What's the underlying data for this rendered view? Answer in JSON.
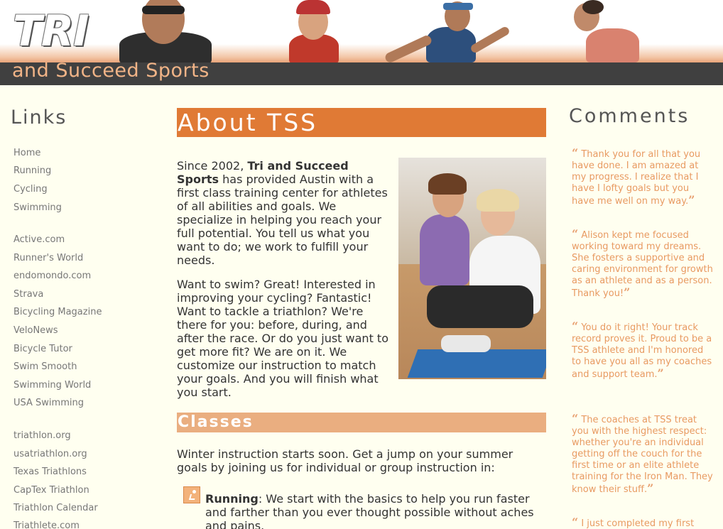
{
  "header": {
    "logo_main": "TRI",
    "logo_sub": "and Succeed Sports"
  },
  "sidebar": {
    "title": "Links",
    "groups": [
      [
        "Home",
        "Running",
        "Cycling",
        "Swimming"
      ],
      [
        "Active.com",
        "Runner's World",
        "endomondo.com",
        "Strava",
        "Bicycling Magazine",
        "VeloNews",
        "Bicycle Tutor",
        "Swim Smooth",
        "Swimming World",
        "USA Swimming"
      ],
      [
        "triathlon.org",
        "usatriathlon.org",
        "Texas Triathlons",
        "CapTex Triathlon",
        "Triathlon Calendar",
        "Triathlete.com"
      ]
    ]
  },
  "main": {
    "about_title": "About TSS",
    "about_p1_prefix": "Since 2002, ",
    "about_p1_bold": "Tri and Succeed Sports",
    "about_p1_rest": " has provided Austin with a first class training center for athletes of all abilities and goals. We specialize in helping you reach your full potential. You tell us what you want to do; we work to fulfill your needs.",
    "about_p2": "Want to swim? Great! Interested in improving your cycling? Fantastic! Want to tackle a triathlon? We're there for you: before, during, and after the race. Or do you just want to get more fit? We are on it. We customize our instruction to match your goals. And you will finish what you start.",
    "classes_title": "Classes",
    "classes_intro": "Winter instruction starts soon. Get a jump on your summer goals by joining us for individual or group instruction in:",
    "running_label": "Running",
    "running_text": ": We start with the basics to help you run faster and farther than you ever thought possible without aches and pains."
  },
  "comments": {
    "title": "Comments",
    "items": [
      "Thank you for all that you have done. I am amazed at my progress. I realize that I have I lofty goals but you have me well on my way.",
      "Alison kept me focused working toward my dreams. She fosters a supportive and caring environment for growth as an athlete and as a person. Thank you!",
      "You do it right! Your track record proves it. Proud to be a TSS athlete and I'm honored to have you all as my coaches and support team.",
      "The coaches at TSS treat you with the highest respect: whether you're an individual getting off the couch for the first time or an elite athlete training for the Iron Man. They know their stuff.",
      "I just completed my first"
    ]
  },
  "colors": {
    "accent": "#e07a35",
    "accent_light": "#eaae80",
    "comment_text": "#e89a62",
    "background": "#fffff0",
    "header_strip": "#404040"
  }
}
